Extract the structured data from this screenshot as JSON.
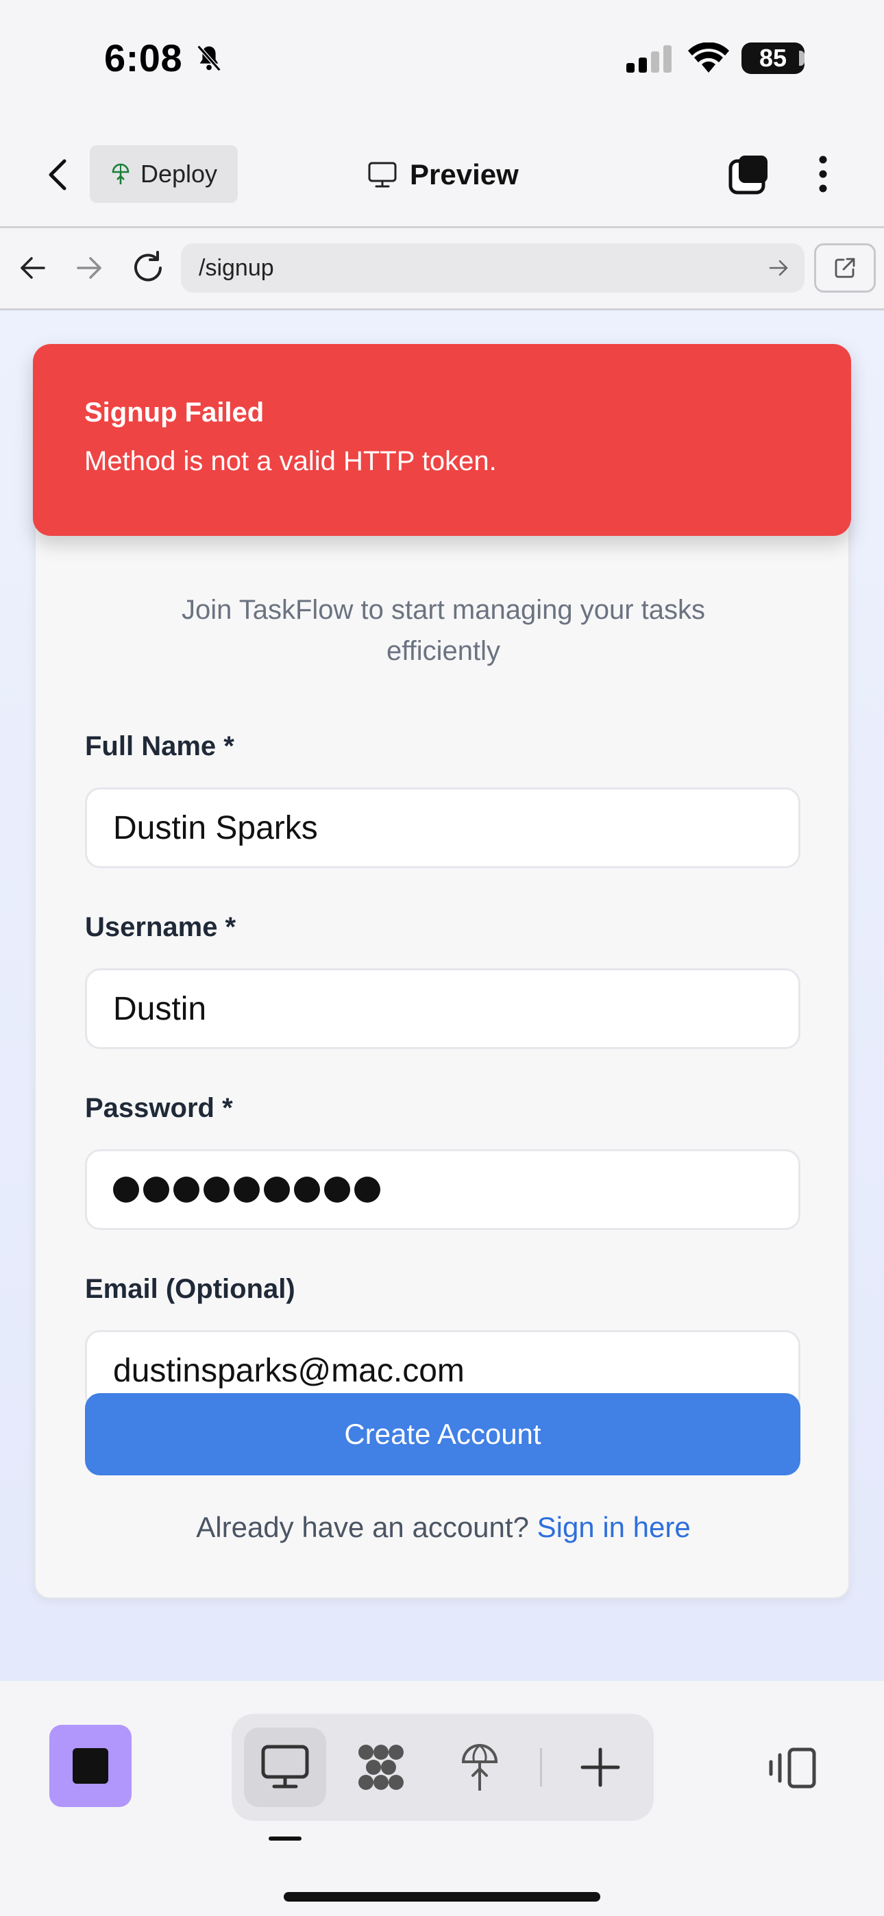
{
  "status_bar": {
    "time": "6:08",
    "battery": "85",
    "icons": [
      "bell-slash-icon",
      "signal-icon",
      "wifi-icon",
      "battery-icon"
    ]
  },
  "header": {
    "deploy_label": "Deploy",
    "title": "Preview"
  },
  "browser": {
    "url": "/signup"
  },
  "toast": {
    "title": "Signup Failed",
    "message": "Method is not a valid HTTP token."
  },
  "form": {
    "subtitle_partial": "Join TaskFlow to start managing your tasks efficiently",
    "full_name_label": "Full Name *",
    "full_name_value": "Dustin Sparks",
    "username_label": "Username *",
    "username_value": "Dustin",
    "password_label": "Password *",
    "password_length": 9,
    "email_label": "Email (Optional)",
    "email_value": "dustinsparks@mac.com",
    "submit_label": "Create Account",
    "signin_prompt": "Already have an account?",
    "signin_link": "Sign in here"
  },
  "toolbar": {
    "icons": [
      "stop-icon",
      "desktop-icon",
      "agents-icon",
      "deploy-icon",
      "plus-icon",
      "panel-icon"
    ]
  },
  "colors": {
    "toast_bg": "#ef4444",
    "primary": "#4180e4",
    "link": "#2f6fdb",
    "stop_bg": "#b197fc"
  }
}
